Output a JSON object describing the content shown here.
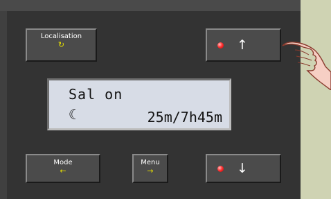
{
  "buttons": {
    "localisation": {
      "label": "Localisation",
      "sub_icon": "↻"
    },
    "up": {
      "arrow": "↑"
    },
    "mode": {
      "label": "Mode",
      "sub_icon": "←"
    },
    "menu": {
      "label": "Menu",
      "sub_icon": "→"
    },
    "down": {
      "arrow": "↓"
    }
  },
  "display": {
    "line1": "Sal on",
    "moon_icon": "☾",
    "line2_value": "25m/7h45m"
  },
  "colors": {
    "led": "#ff3333",
    "accent_yellow": "#e8e000",
    "background": "#cfd3b3"
  }
}
